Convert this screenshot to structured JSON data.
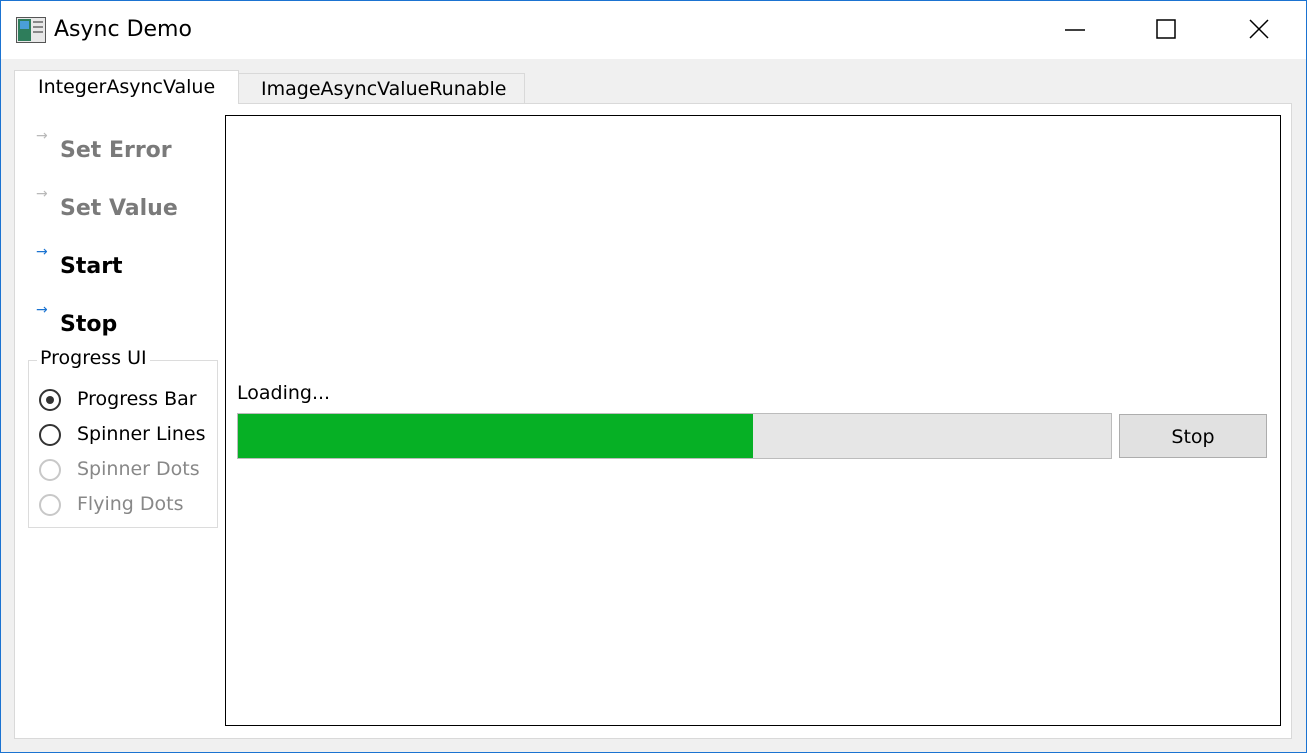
{
  "window": {
    "title": "Async Demo"
  },
  "tabs": [
    {
      "label": "IntegerAsyncValue",
      "active": true
    },
    {
      "label": "ImageAsyncValueRunable",
      "active": false
    }
  ],
  "commands": [
    {
      "arrow": "→",
      "label": "Set Error",
      "enabled": false
    },
    {
      "arrow": "→",
      "label": "Set Value",
      "enabled": false
    },
    {
      "arrow": "→",
      "label": "Start",
      "enabled": true
    },
    {
      "arrow": "→",
      "label": "Stop",
      "enabled": true
    }
  ],
  "progress_ui": {
    "title": "Progress UI",
    "options": [
      {
        "label": "Progress Bar",
        "checked": true,
        "enabled": true
      },
      {
        "label": "Spinner Lines",
        "checked": false,
        "enabled": true
      },
      {
        "label": "Spinner Dots",
        "checked": false,
        "enabled": false
      },
      {
        "label": "Flying Dots",
        "checked": false,
        "enabled": false
      }
    ]
  },
  "content": {
    "loading_text": "Loading...",
    "progress_fraction": 0.59,
    "stop_label": "Stop"
  },
  "colors": {
    "progress_fill": "#06b025",
    "accent": "#1b73d1"
  }
}
